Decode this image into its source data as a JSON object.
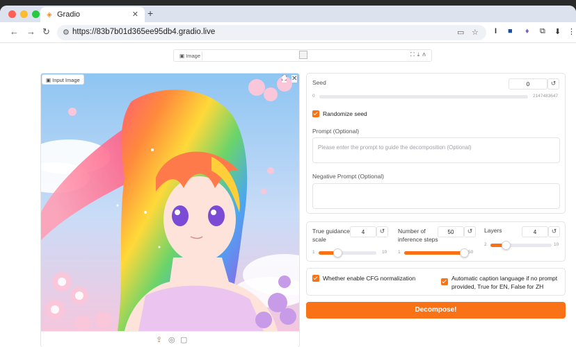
{
  "browser": {
    "tab_title": "Gradio",
    "tab_icon": "gradio-logo-icon",
    "new_tab": "+",
    "url": "https://83b7b01d365ee95db4.gradio.live",
    "nav_back": "←",
    "nav_forward": "→",
    "nav_reload": "↻",
    "extensions": [
      "I",
      "⬛",
      "♠",
      "⧉",
      "⬇",
      "⋮"
    ]
  },
  "output_image": {
    "label": "Image"
  },
  "input_image": {
    "label": "Input Image"
  },
  "seed": {
    "label": "Seed",
    "value": "0",
    "min": "0",
    "max": "2147483647",
    "fraction": 0
  },
  "randomize_seed": {
    "label": "Randomize seed",
    "checked": true
  },
  "prompt": {
    "label": "Prompt (Optional)",
    "placeholder": "Please enter the prompt to guide the decomposition (Optional)"
  },
  "negative_prompt": {
    "label": "Negative Prompt (Optional)"
  },
  "true_guidance": {
    "label_line1": "True guidance",
    "label_line2": "scale",
    "value": "4",
    "min": "1",
    "max": "10",
    "fraction": 0.33
  },
  "inference_steps": {
    "label_line1": "Number of",
    "label_line2": "inference steps",
    "value": "50",
    "min": "1",
    "max": "50",
    "fraction": 1.0
  },
  "layers": {
    "label": "Layers",
    "value": "4",
    "min": "2",
    "max": "10",
    "fraction": 0.25
  },
  "cfg_norm": {
    "label": "Whether enable CFG normalization",
    "checked": true
  },
  "caption_lang": {
    "label_line1": "Automatic caption language if no prompt",
    "label_line2": "provided, True for EN, False for ZH",
    "checked": true
  },
  "decompose_button": "Decompose!",
  "colors": {
    "accent": "#f97316",
    "border": "#e4e4e7"
  }
}
